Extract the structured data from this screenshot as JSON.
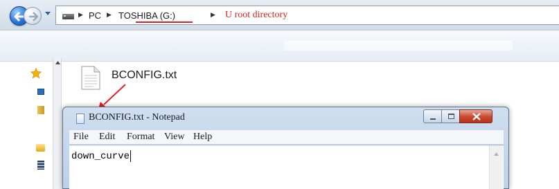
{
  "address_bar": {
    "crumbs": [
      "PC",
      "TOSHIBA (G:)"
    ],
    "annotation": "U root directory",
    "annotation_color": "#e02020",
    "icons": [
      "back-arrow-icon",
      "forward-arrow-icon",
      "dropdown-icon",
      "drive-icon",
      "chevron-right-icon"
    ]
  },
  "nav_pane": {
    "icons": [
      "favorites-star-icon",
      "desktop-icon",
      "folder-icon",
      "libraries-icon",
      "video-icon"
    ]
  },
  "file_list": {
    "items": [
      {
        "name": "BCONFIG.txt",
        "icon": "text-file-icon"
      }
    ]
  },
  "notepad": {
    "title": "BCONFIG.txt - Notepad",
    "menu": [
      "File",
      "Edit",
      "Format",
      "View",
      "Help"
    ],
    "content": "down_curve",
    "controls": [
      "minimize-icon",
      "maximize-icon",
      "close-icon"
    ]
  }
}
